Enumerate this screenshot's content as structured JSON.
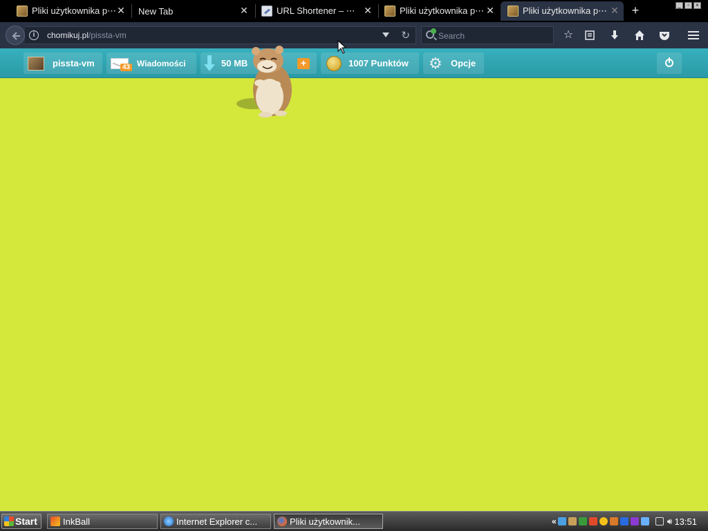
{
  "browser": {
    "tabs": [
      {
        "title": "Pliki użytkownika p⋯",
        "icon": "hamster-favicon-icon",
        "active": false
      },
      {
        "title": "New Tab",
        "icon": "",
        "active": false
      },
      {
        "title": "URL Shortener – ⋯",
        "icon": "link-favicon-icon",
        "active": false
      },
      {
        "title": "Pliki użytkownika p⋯",
        "icon": "hamster-favicon-icon",
        "active": false
      },
      {
        "title": "Pliki użytkownika p⋯",
        "icon": "hamster-favicon-icon",
        "active": true
      }
    ],
    "close_glyph": "✕",
    "new_tab_glyph": "+",
    "url_host": "chomikuj.pl",
    "url_path": "/pissta-vm",
    "search_placeholder": "Search",
    "reload_glyph": "↻"
  },
  "site_header": {
    "username": "pissta-vm",
    "messages_label": "Wiadomości",
    "messages_count": "43",
    "transfer_label": "50 MB",
    "transfer_add_glyph": "+",
    "points_label": "1007 Punktów",
    "options_label": "Opcje"
  },
  "taskbar": {
    "start_label": "Start",
    "items": [
      {
        "label": "InkBall",
        "active": false
      },
      {
        "label": "Internet Explorer c...",
        "active": false
      },
      {
        "label": "Pliki użytkownik...",
        "active": true
      }
    ],
    "tray_expand": "«",
    "clock": "13:51"
  },
  "colors": {
    "page_background": "#d3e83b",
    "header_teal": "#2fa4b1",
    "accent_orange": "#f39a2a"
  }
}
